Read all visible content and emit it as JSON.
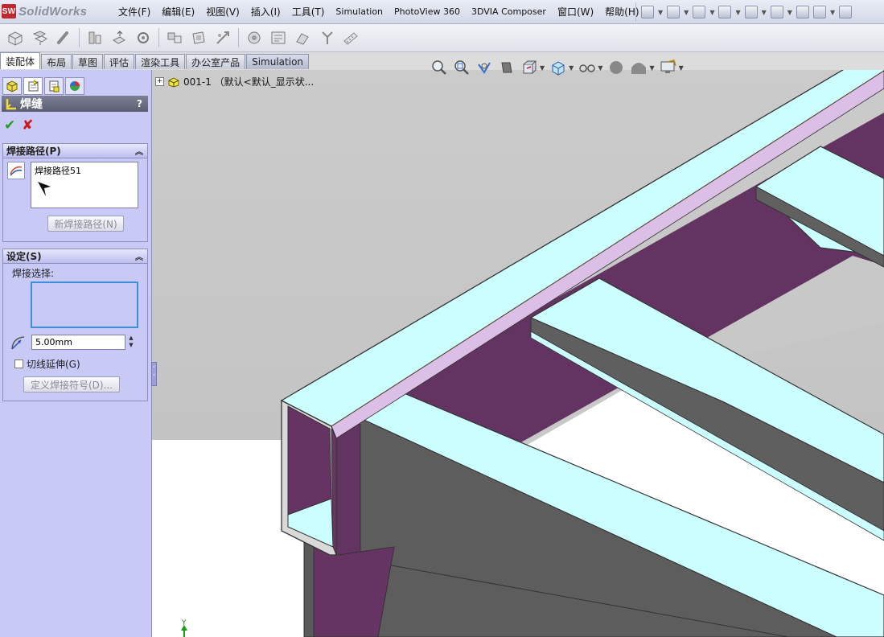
{
  "app": {
    "logo_text": "SolidWorks",
    "logo_mark": "SW"
  },
  "menu": {
    "items": [
      "文件(F)",
      "编辑(E)",
      "视图(V)",
      "插入(I)",
      "工具(T)",
      "Simulation",
      "PhotoView 360",
      "3DVIA Composer",
      "窗口(W)",
      "帮助(H)"
    ]
  },
  "tabs": [
    "装配体",
    "布局",
    "草图",
    "评估",
    "渲染工具",
    "办公室产品",
    "Simulation"
  ],
  "feature_tree": {
    "root": "001-1 （默认<默认_显示状..."
  },
  "property_manager": {
    "title": "焊缝",
    "help": "?",
    "weld_path_group": {
      "title": "焊接路径(P)",
      "item": "焊接路径51",
      "new_button": "新焊接路径(N)"
    },
    "settings_group": {
      "title": "设定(S)",
      "weld_selection_label": "焊接选择:",
      "bead_size": "5.00mm",
      "tangent_label": "切线延伸(G)",
      "tangent_checked": false,
      "define_symbol_button": "定义焊接符号(D)..."
    }
  },
  "colors": {
    "background_upper": "#c9c9c9",
    "background_lower": "#ffffff",
    "tube_face_top": "#ccffff",
    "tube_face_side": "#626262",
    "tube_inner": "#6a3565",
    "panel_bg": "#c8c9f5",
    "selection_border": "#3f8fd6",
    "weld_line": "#e8960f"
  },
  "icons": {
    "heads_up": [
      "zoom-to-fit-icon",
      "zoom-area-icon",
      "previous-view-icon",
      "section-view-icon",
      "view-orientation-icon",
      "display-style-icon",
      "hide-show-icon",
      "edit-appearance-icon",
      "apply-scene-icon",
      "view-settings-icon"
    ]
  },
  "triad_label": "Y"
}
